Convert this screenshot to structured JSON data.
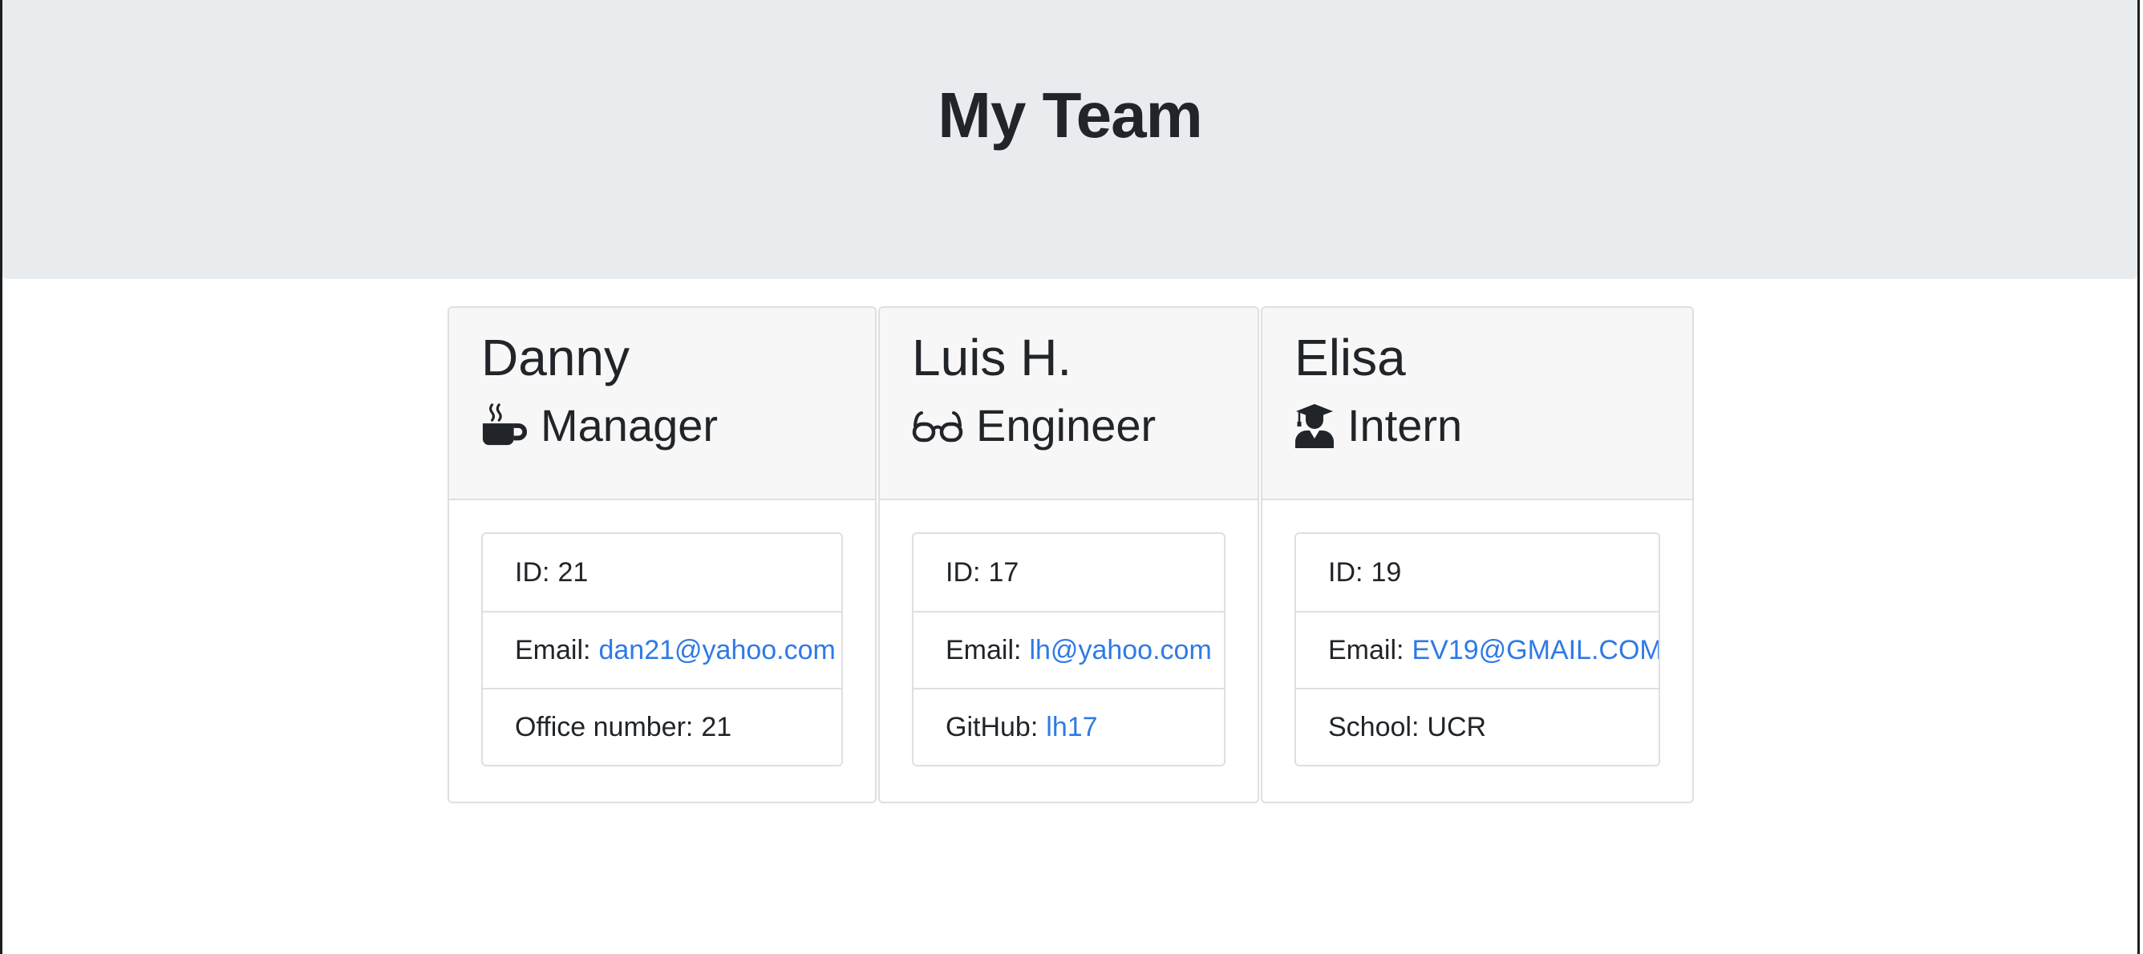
{
  "header": {
    "title": "My Team"
  },
  "team": [
    {
      "name": "Danny",
      "role": "Manager",
      "role_icon": "coffee-mug-icon",
      "details": {
        "id_label": "ID:",
        "id_value": "21",
        "email_label": "Email:",
        "email_value": "dan21@yahoo.com",
        "extra_label": "Office number:",
        "extra_value": "21"
      }
    },
    {
      "name": "Luis H.",
      "role": "Engineer",
      "role_icon": "glasses-icon",
      "details": {
        "id_label": "ID:",
        "id_value": "17",
        "email_label": "Email:",
        "email_value": "lh@yahoo.com",
        "extra_label": "GitHub:",
        "extra_value": "lh17"
      }
    },
    {
      "name": "Elisa",
      "role": "Intern",
      "role_icon": "graduate-icon",
      "details": {
        "id_label": "ID:",
        "id_value": "19",
        "email_label": "Email:",
        "email_value": "EV19@GMAIL.COM",
        "extra_label": "School:",
        "extra_value": "UCR"
      }
    }
  ],
  "colors": {
    "jumbotron_bg": "#e9ecef",
    "link": "#2f7ae5",
    "card_header_bg": "#f7f7f7",
    "border": "#dfdfdf",
    "text": "#212529"
  }
}
